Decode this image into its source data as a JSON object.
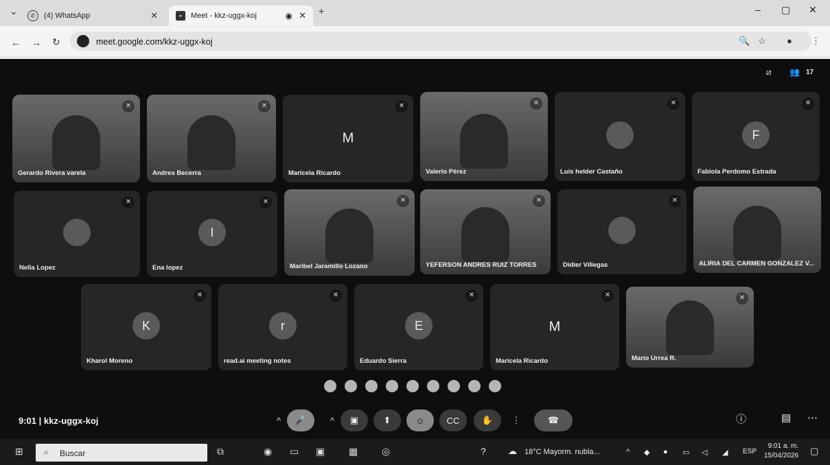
{
  "browser": {
    "tabs": [
      {
        "title": "(4) WhatsApp",
        "active": false
      },
      {
        "title": "Meet - kkz-uggx-koj",
        "active": true
      }
    ],
    "url": "meet.google.com/kkz-uggx-koj"
  },
  "meeting": {
    "time": "9:01",
    "separator": "|",
    "code": "kkz-uggx-koj",
    "participant_count": "17"
  },
  "tiles": [
    {
      "name": "Gerardo Rivera varela",
      "type": "video",
      "letter": ""
    },
    {
      "name": "Andres Becerra",
      "type": "video",
      "letter": ""
    },
    {
      "name": "Maricela Ricardo",
      "type": "letter",
      "letter": "M"
    },
    {
      "name": "Valerio Pérez",
      "type": "video",
      "letter": ""
    },
    {
      "name": "Luis helder Castaño",
      "type": "avatar-photo",
      "letter": ""
    },
    {
      "name": "Fabiola Perdomo Estrada",
      "type": "avatar",
      "letter": "F"
    },
    {
      "name": "Nella Lopez",
      "type": "avatar-photo",
      "letter": ""
    },
    {
      "name": "Ena lopez",
      "type": "avatar",
      "letter": "I"
    },
    {
      "name": "Maribel Jaramillo Lozano",
      "type": "video",
      "letter": ""
    },
    {
      "name": "YEFERSON ANDRES RUIZ TORRES",
      "type": "video",
      "letter": ""
    },
    {
      "name": "Didier Villegas",
      "type": "avatar-photo",
      "letter": ""
    },
    {
      "name": "ALIRIA DEL CARMEN GONZALEZ V...",
      "type": "video",
      "letter": ""
    },
    {
      "name": "Kharol Moreno",
      "type": "avatar",
      "letter": "K"
    },
    {
      "name": "read.ai meeting notes",
      "type": "avatar",
      "letter": "r"
    },
    {
      "name": "Eduardo Sierra",
      "type": "avatar",
      "letter": "E"
    },
    {
      "name": "Maricela Ricardo",
      "type": "letter",
      "letter": "M"
    },
    {
      "name": "Mario Urrea R.",
      "type": "video",
      "letter": ""
    }
  ],
  "taskbar": {
    "search_placeholder": "Buscar",
    "weather": "18°C  Mayorm. nubla...",
    "lang": "ESP",
    "clock_time": "9:01 a. m.",
    "clock_date": "15/04/2026"
  }
}
